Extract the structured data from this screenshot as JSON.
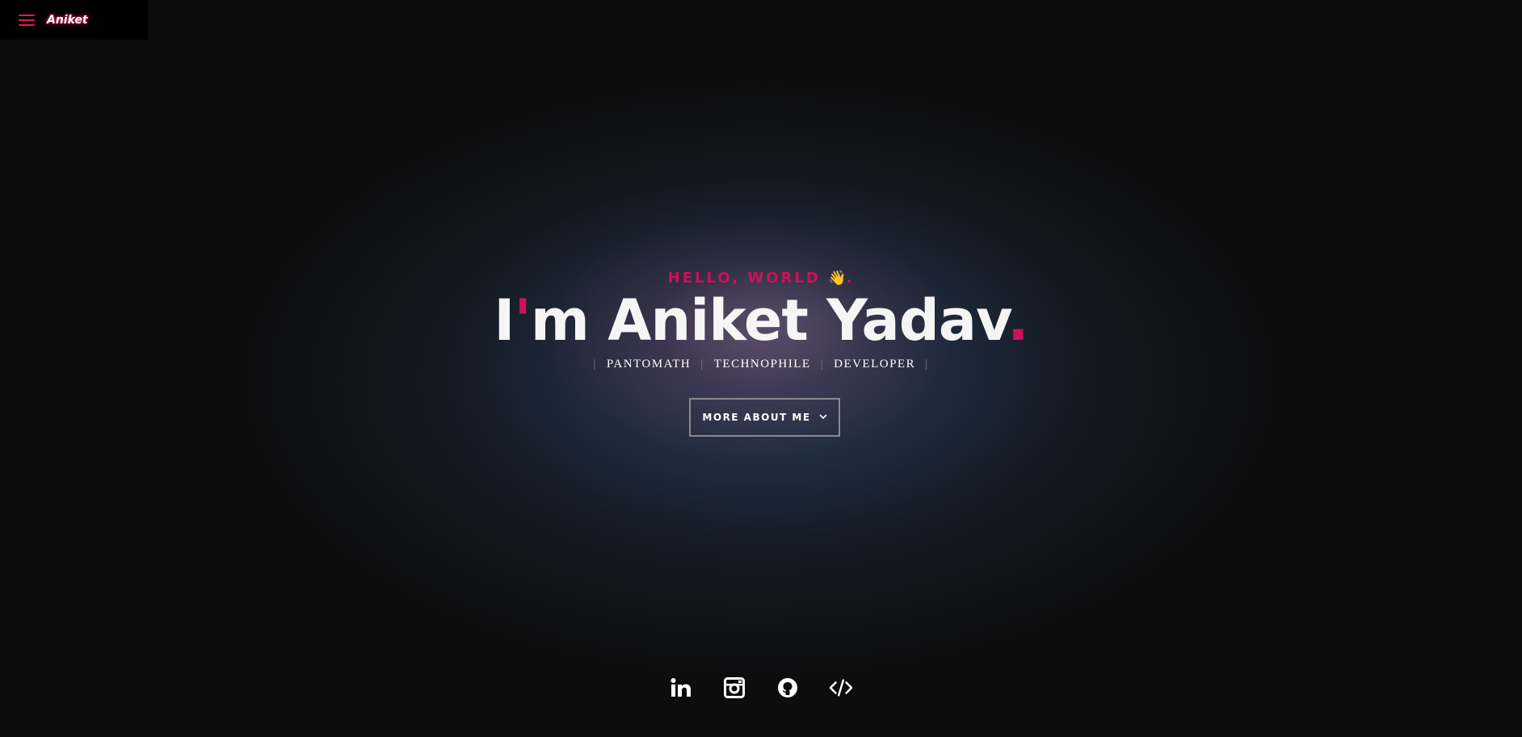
{
  "nav": {
    "menu_icon": "hamburger-menu-icon",
    "brand": "Aniket"
  },
  "hero": {
    "greeting": "HELLO, WORLD",
    "greeting_emoji": "👋",
    "greeting_suffix": ".",
    "name_first_letter": "I",
    "name_apostrophe": "'",
    "name_rest": "m Aniket Yadav",
    "name_dot": ".",
    "roles": [
      "PANTOMATH",
      "TECHNOPHILE",
      "DEVELOPER"
    ],
    "cta_label": "MORE ABOUT ME",
    "cta_icon": "chevron-down-icon"
  },
  "socials": [
    {
      "icon": "linkedin-icon",
      "label": "LinkedIn"
    },
    {
      "icon": "instagram-icon",
      "label": "Instagram"
    },
    {
      "icon": "github-icon",
      "label": "GitHub"
    },
    {
      "icon": "code-icon",
      "label": "Code"
    }
  ],
  "colors": {
    "accent": "#cc1158",
    "background": "#0d0d0e",
    "text": "#ffffff"
  }
}
